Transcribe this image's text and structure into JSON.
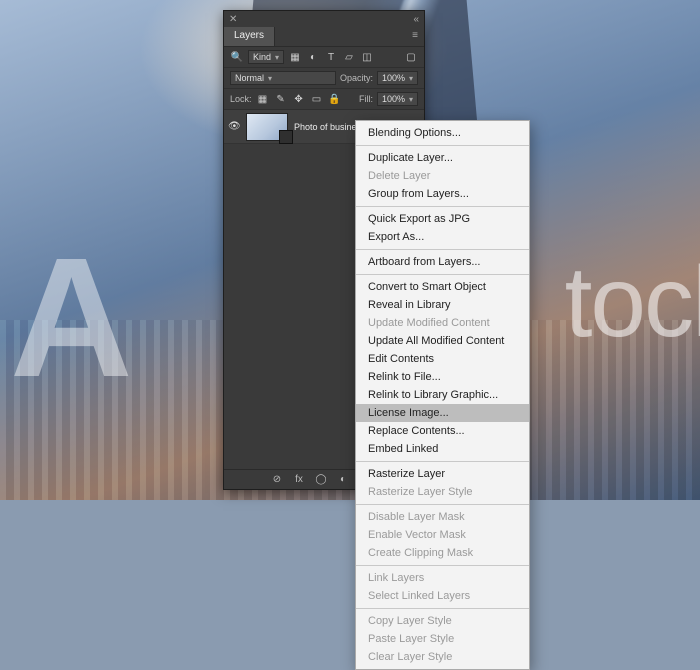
{
  "watermark": {
    "a": "A",
    "stock": "tock"
  },
  "panel": {
    "title": "Layers",
    "filters": {
      "kind_label": "Kind",
      "blend_mode": "Normal",
      "opacity_label": "Opacity:",
      "opacity_value": "100%",
      "lock_label": "Lock:",
      "fill_label": "Fill:",
      "fill_value": "100%"
    },
    "layer": {
      "name": "Photo of  busines"
    },
    "footer_icons": {
      "link": "⊘",
      "fx": "fx",
      "mask": "◯",
      "adjust": "◐",
      "group": "▭",
      "new": "▣",
      "trash": "🗑"
    }
  },
  "context_menu": {
    "groups": [
      [
        {
          "label": "Blending Options...",
          "enabled": true
        }
      ],
      [
        {
          "label": "Duplicate Layer...",
          "enabled": true
        },
        {
          "label": "Delete Layer",
          "enabled": false
        },
        {
          "label": "Group from Layers...",
          "enabled": true
        }
      ],
      [
        {
          "label": "Quick Export as JPG",
          "enabled": true
        },
        {
          "label": "Export As...",
          "enabled": true
        }
      ],
      [
        {
          "label": "Artboard from Layers...",
          "enabled": true
        }
      ],
      [
        {
          "label": "Convert to Smart Object",
          "enabled": true
        },
        {
          "label": "Reveal in Library",
          "enabled": true
        },
        {
          "label": "Update Modified Content",
          "enabled": false
        },
        {
          "label": "Update All Modified Content",
          "enabled": true
        },
        {
          "label": "Edit Contents",
          "enabled": true
        },
        {
          "label": "Relink to File...",
          "enabled": true
        },
        {
          "label": "Relink to Library Graphic...",
          "enabled": true
        },
        {
          "label": "License Image...",
          "enabled": true,
          "highlight": true
        },
        {
          "label": "Replace Contents...",
          "enabled": true
        },
        {
          "label": "Embed Linked",
          "enabled": true
        }
      ],
      [
        {
          "label": "Rasterize Layer",
          "enabled": true
        },
        {
          "label": "Rasterize Layer Style",
          "enabled": false
        }
      ],
      [
        {
          "label": "Disable Layer Mask",
          "enabled": false
        },
        {
          "label": "Enable Vector Mask",
          "enabled": false
        },
        {
          "label": "Create Clipping Mask",
          "enabled": false
        }
      ],
      [
        {
          "label": "Link Layers",
          "enabled": false
        },
        {
          "label": "Select Linked Layers",
          "enabled": false
        }
      ],
      [
        {
          "label": "Copy Layer Style",
          "enabled": false
        },
        {
          "label": "Paste Layer Style",
          "enabled": false
        },
        {
          "label": "Clear Layer Style",
          "enabled": false
        }
      ]
    ]
  }
}
